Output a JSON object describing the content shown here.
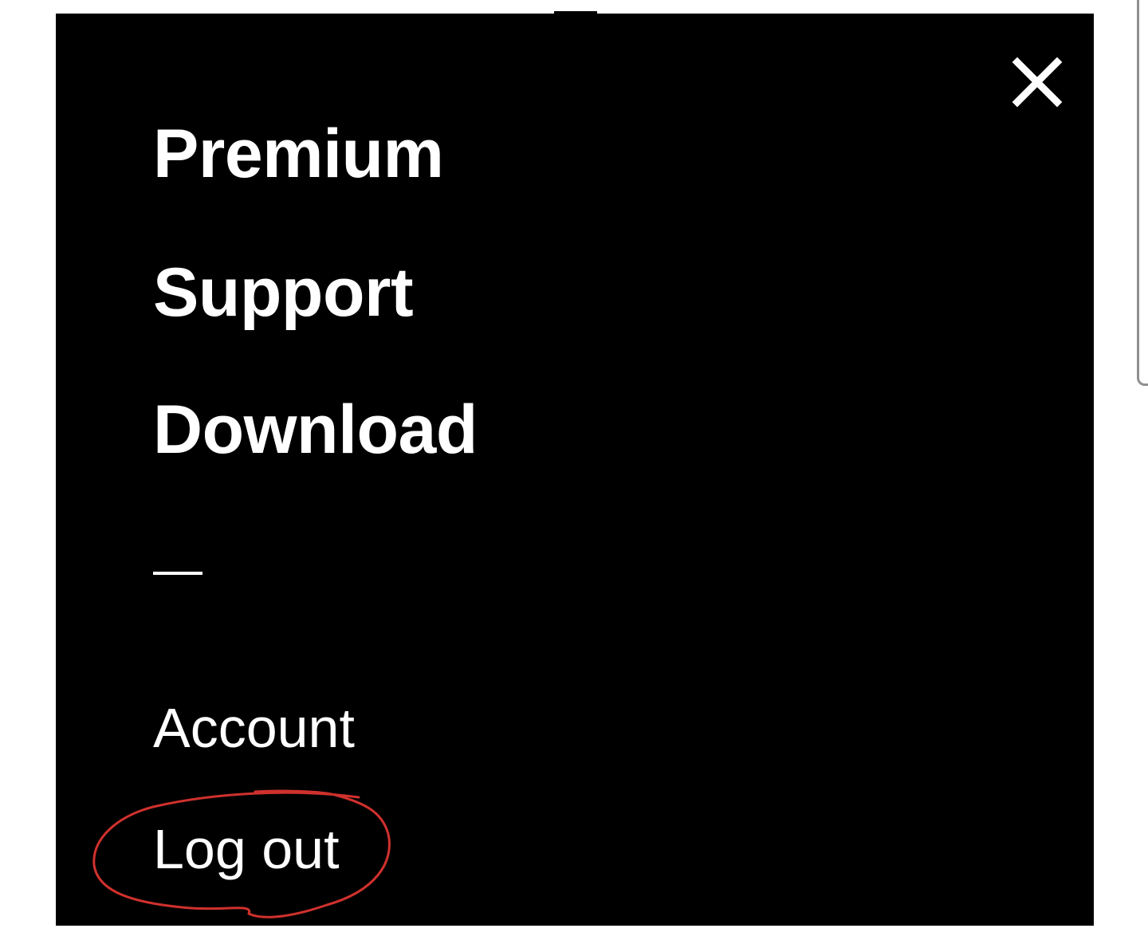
{
  "menu": {
    "close_icon": "close-icon",
    "primary_items": [
      {
        "label": "Premium"
      },
      {
        "label": "Support"
      },
      {
        "label": "Download"
      }
    ],
    "divider": "—",
    "secondary_items": [
      {
        "label": "Account"
      },
      {
        "label": "Log out"
      }
    ]
  },
  "colors": {
    "background": "#000000",
    "text": "#ffffff",
    "annotation": "#d0312d"
  }
}
